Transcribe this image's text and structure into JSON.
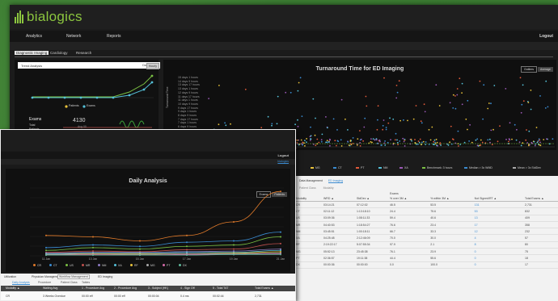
{
  "brand": {
    "name": "bialogics",
    "color": "#8cc63f"
  },
  "back_window": {
    "nav": [
      "Analytics",
      "Network",
      "Reports"
    ],
    "user_menu": "Logout",
    "tabs": [
      "Diagnostic Imaging",
      "Cardiology",
      "Research"
    ],
    "trend_panel": {
      "header": "Trend Analysis",
      "segments": [
        "Daily",
        "Hourly"
      ],
      "legend": [
        "Patients",
        "Exams"
      ],
      "exams_label": "Exams",
      "exams_value": "4130",
      "rows": [
        "Total",
        "Patients"
      ],
      "sub_value": "Avg 00"
    },
    "chart": {
      "title": "Turnaround Time for ED Imaging",
      "buttons": [
        "Outliers",
        "Average"
      ],
      "y_axis_label": "Turnaround Time",
      "y_ticks": [
        "15 days 1 hours",
        "14 days 9 hours",
        "13 days 17 hours",
        "13 days 1 hours",
        "12 days 9 hours",
        "11 days 17 hours",
        "11 days 1 hours",
        "10 days 9 hours",
        "9 days 17 hours",
        "9 days 1 hours",
        "8 days 9 hours",
        "7 days 17 hours",
        "7 days 1 hours",
        "6 days 9 hours",
        "5 days 17 hours",
        "5 days 1 hours",
        "4 days 9 hours",
        "3 days 17 hours",
        "3 days 1 hours",
        "2 days 9 hours",
        "1 day 17 hours",
        "1 day 1 hours",
        "0 days 9 hours"
      ],
      "legend": [
        "MG",
        "CT",
        "PT",
        "NM",
        "XA",
        "Benchmark: 3 hours",
        "Median > 3x WMD",
        "Mean > 3x StdDev"
      ],
      "colors": [
        "#e8c23a",
        "#3a8bd1",
        "#e05a3a",
        "#55c0d8",
        "#9b59b6"
      ]
    },
    "table": {
      "tabs": [
        "Data Management",
        "ED Imaging"
      ],
      "filters": [
        "Patient Class",
        "Modality"
      ],
      "group_header": "Exams",
      "columns": [
        "Modality",
        "WRD ▲",
        "StdDev ▲",
        "% over 3M ▲",
        "% within 3M ▲",
        "Not Signed/RT ▲",
        "Total Exams ▲"
      ],
      "rows": [
        [
          "CR",
          "03:14:21",
          "07:12:02",
          "46.5",
          "53.5",
          "131",
          "2,731"
        ],
        [
          "CT",
          "02:11:12",
          "1:13:18:10",
          "24.4",
          "75.6",
          "53",
          "832"
        ],
        [
          "US",
          "03:09:36",
          "1:08:11:33",
          "59.4",
          "40.6",
          "13",
          "409"
        ],
        [
          "MR",
          "04:40:53",
          "1:18:54:27",
          "76.6",
          "23.4",
          "17",
          "358"
        ],
        [
          "NM",
          "03:45:51",
          "1:00:18:11",
          "66.7",
          "33.3",
          "12",
          "232"
        ],
        [
          "XA",
          "04:25:48",
          "2:12:46:09",
          "70.0",
          "30.0",
          "4",
          "57"
        ],
        [
          "RF",
          "2:19:22:17",
          "5:07:55:34",
          "97.9",
          "2.1",
          "8",
          "80"
        ],
        [
          "MG",
          "05:52:13",
          "23:45:38",
          "76.1",
          "23.9",
          "0",
          "75"
        ],
        [
          "PT",
          "02:36:57",
          "19:11:38",
          "44.4",
          "55.6",
          "0",
          "18"
        ],
        [
          "DX",
          "00:00:36",
          "00:00:00",
          "0.0",
          "100.0",
          "0",
          "17"
        ]
      ]
    }
  },
  "front_window": {
    "user_menu": "Logout",
    "user_sub": "bialogics",
    "chart": {
      "title": "Daily Analysis",
      "buttons": [
        "Exams",
        "Patients"
      ],
      "x_ticks": [
        "11 Jan",
        "13 Jan",
        "15 Jan",
        "17 Jan",
        "19 Jan",
        "21 Jan"
      ],
      "y_ticks": [
        "140",
        "120",
        "100",
        "80",
        "60",
        "40",
        "20",
        "0"
      ],
      "legend": [
        "CR",
        "CT",
        "US",
        "MR",
        "NM",
        "XA",
        "RF",
        "MG",
        "PT",
        "DX"
      ],
      "colors": [
        "#e07a2a",
        "#3a8bd1",
        "#7ac043",
        "#c0504d",
        "#8e7cc3",
        "#55c0d8",
        "#e8c23a",
        "#aaaaaa",
        "#d46aa8",
        "#5fb89a"
      ]
    },
    "tabs": [
      "Utilization",
      "Physician Management",
      "Workflow Management",
      "ED Imaging"
    ],
    "subtabs": [
      "Daily Analysis",
      "Procedure",
      "Patient Class",
      "Tables"
    ],
    "columns": [
      "Modality ▲",
      "Waiting Avg",
      "1 - Procedure Avg",
      "2 - Procedure Avg",
      "3 - Subject (HK)",
      "4 - Sign Off",
      "5 - Total TAT",
      "Total Exams ▲"
    ],
    "row": [
      "CR",
      "3 Weeks Overdue",
      "00:00 eff",
      "00:00 eff",
      "00:00:04",
      "0.4 ms",
      "00:02:44",
      "2,731"
    ]
  }
}
